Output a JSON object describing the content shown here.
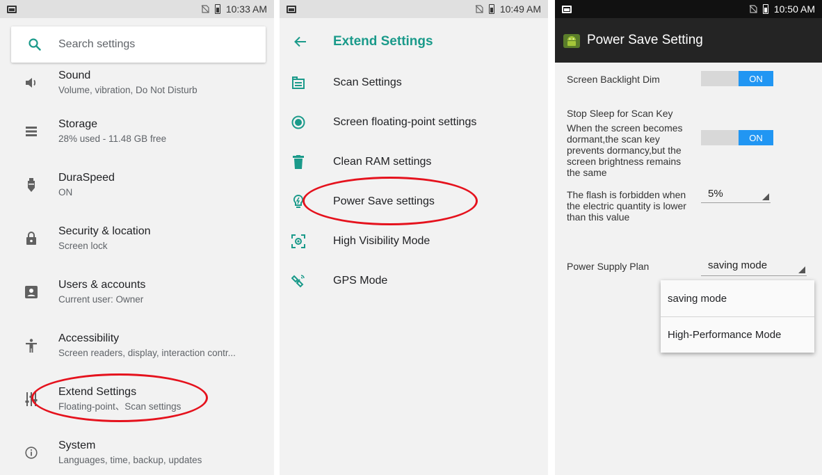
{
  "colors": {
    "accent": "#1a9a8a",
    "highlight": "#e5121d",
    "toggle_on": "#2196f3"
  },
  "panel1": {
    "status_time": "10:33 AM",
    "search_placeholder": "Search settings",
    "items": [
      {
        "title": "Sound",
        "subtitle": "Volume, vibration, Do Not Disturb",
        "icon": "volume-icon"
      },
      {
        "title": "Storage",
        "subtitle": "28% used - 11.48 GB free",
        "icon": "storage-icon"
      },
      {
        "title": "DuraSpeed",
        "subtitle": "ON",
        "icon": "duraspeed-icon"
      },
      {
        "title": "Security & location",
        "subtitle": "Screen lock",
        "icon": "lock-icon"
      },
      {
        "title": "Users & accounts",
        "subtitle": "Current user: Owner",
        "icon": "account-icon"
      },
      {
        "title": "Accessibility",
        "subtitle": "Screen readers, display, interaction contr...",
        "icon": "accessibility-icon"
      },
      {
        "title": "Extend Settings",
        "subtitle": "Floating-point、Scan settings",
        "icon": "extend-settings-icon"
      },
      {
        "title": "System",
        "subtitle": "Languages, time, backup, updates",
        "icon": "info-icon"
      }
    ]
  },
  "panel2": {
    "status_time": "10:49 AM",
    "title": "Extend Settings",
    "items": [
      {
        "label": "Scan Settings",
        "icon": "scan-icon"
      },
      {
        "label": "Screen floating-point settings",
        "icon": "floating-point-icon"
      },
      {
        "label": "Clean RAM settings",
        "icon": "trash-icon"
      },
      {
        "label": "Power Save settings",
        "icon": "power-save-icon"
      },
      {
        "label": "High Visibility Mode",
        "icon": "visibility-icon"
      },
      {
        "label": "GPS Mode",
        "icon": "gps-icon"
      }
    ]
  },
  "panel3": {
    "status_time": "10:50 AM",
    "title": "Power Save Setting",
    "backlight_label": "Screen Backlight Dim",
    "backlight_state": "ON",
    "stop_sleep_label": "Stop Sleep for Scan Key",
    "stop_sleep_desc": "When the screen becomes dormant,the scan key prevents dormancy,but the screen brightness remains the same",
    "stop_sleep_state": "ON",
    "flash_label": "The flash is forbidden when the electric quantity is lower than this value",
    "flash_value": "5%",
    "plan_label": "Power Supply Plan",
    "plan_value": "saving mode",
    "plan_options": [
      "saving mode",
      "High-Performance Mode"
    ]
  }
}
